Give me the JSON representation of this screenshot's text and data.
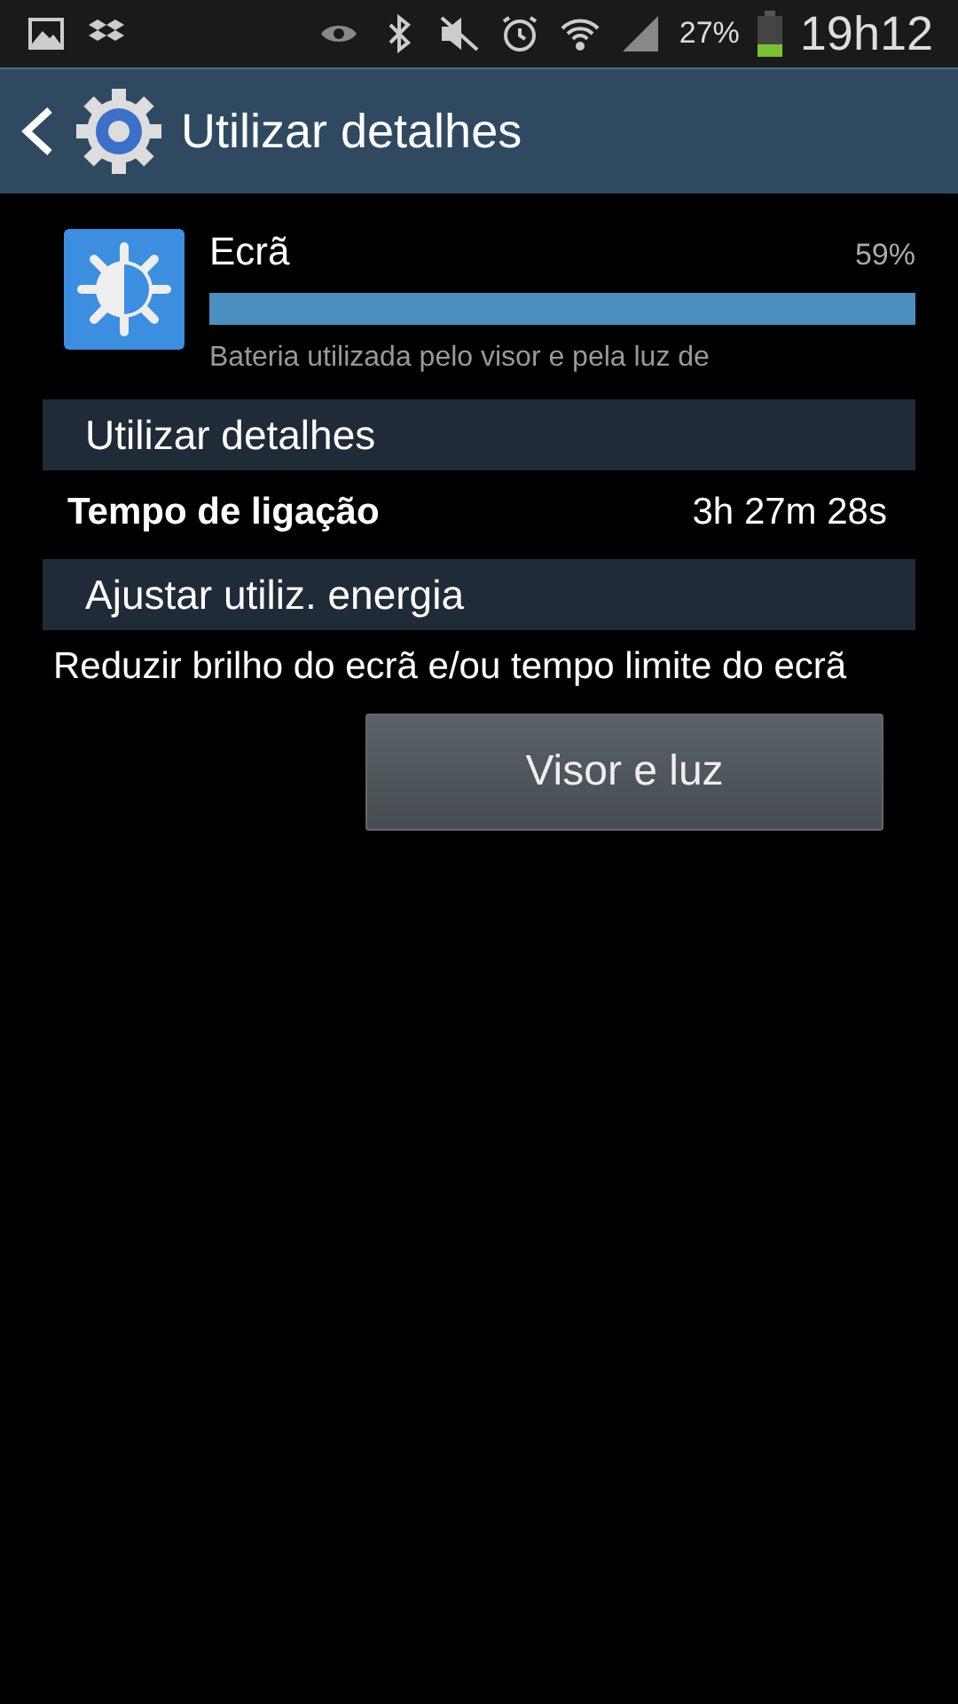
{
  "status_bar": {
    "battery": "27%",
    "time": "19h12"
  },
  "header": {
    "title": "Utilizar detalhes"
  },
  "app": {
    "name": "Ecrã",
    "percent": "59%",
    "level": 1,
    "description": "Bateria utilizada pelo visor e pela luz de"
  },
  "sections": [
    {
      "title": "Utilizar detalhes",
      "rows": [
        {
          "label": "Tempo de ligação",
          "value": "3h 27m 28s"
        }
      ]
    },
    {
      "title": "Ajustar utiliz. energia",
      "text": "Reduzir brilho do ecrã e/ou tempo limite do ecrã",
      "button": "Visor e luz"
    }
  ]
}
